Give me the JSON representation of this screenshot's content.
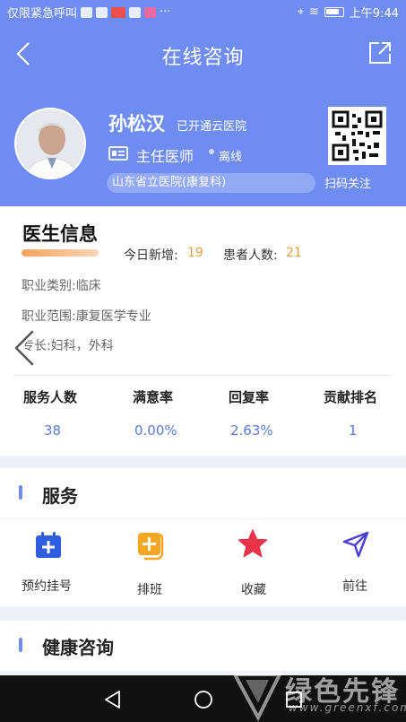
{
  "status_bar": {
    "carrier_text": "仅限紧急呼叫",
    "more": "···",
    "time": "上午9:44"
  },
  "header": {
    "title": "在线咨询"
  },
  "doctor": {
    "name": "孙松汉",
    "status": "已开通云医院",
    "title": "主任医师",
    "online_status": "离线",
    "hospital": "山东省立医院(康复科)",
    "qr_label": "扫码关注"
  },
  "doctor_info": {
    "section_title": "医生信息",
    "today_new_label": "今日新增:",
    "today_new_value": "19",
    "patients_label": "患者人数:",
    "patients_value": "21",
    "category": "职业类别:临床",
    "scope": "职业范围:康复医学专业",
    "specialty": "专长:妇科，外科",
    "stats": [
      {
        "label": "服务人数",
        "value": "38"
      },
      {
        "label": "满意率",
        "value": "0.00%"
      },
      {
        "label": "回复率",
        "value": "2.63%"
      },
      {
        "label": "贡献排名",
        "value": "1"
      }
    ]
  },
  "services": {
    "title": "服务",
    "items": [
      {
        "label": "预约挂号",
        "icon": "calendar-plus-icon"
      },
      {
        "label": "排班",
        "icon": "schedule-plus-icon"
      },
      {
        "label": "收藏",
        "icon": "star-icon"
      },
      {
        "label": "前往",
        "icon": "navigation-icon"
      }
    ]
  },
  "health": {
    "title": "健康咨询"
  },
  "watermark": {
    "text": "绿色先锋",
    "url": "www.greenxf.com"
  },
  "colors": {
    "header_bg": "#6e8cf2",
    "accent_orange": "#e0a040",
    "stat_blue": "#5a7ad6",
    "star_red": "#e8344a",
    "calendar_blue": "#2f5de0",
    "schedule_orange": "#f5a623",
    "nav_purple": "#4b3fd4"
  }
}
